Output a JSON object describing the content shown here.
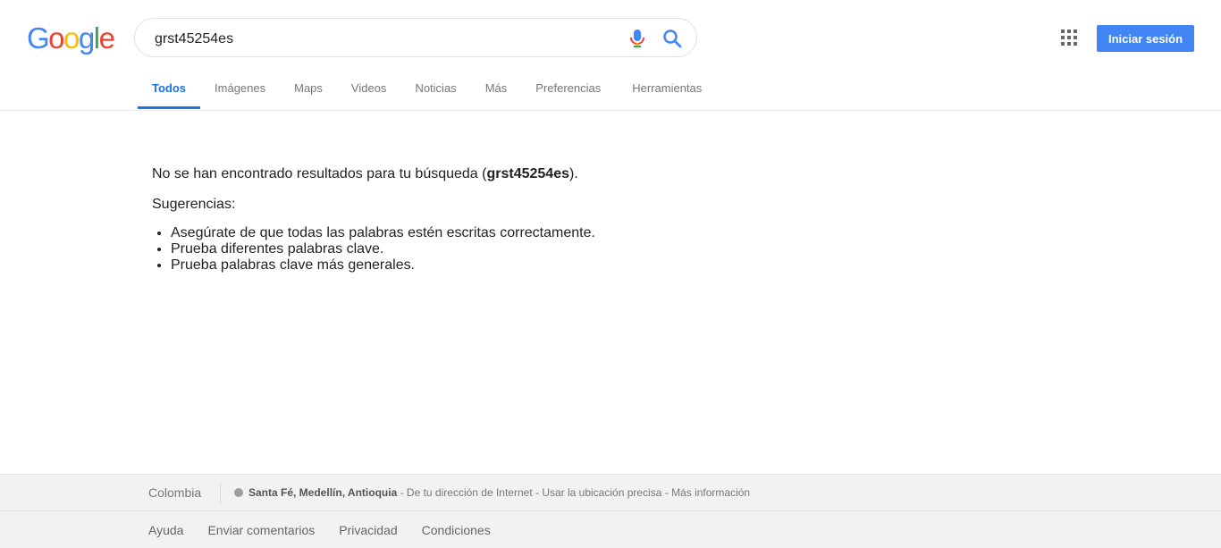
{
  "logo": {
    "letters": [
      "G",
      "o",
      "o",
      "g",
      "l",
      "e"
    ],
    "colors": [
      "#4285f4",
      "#ea4335",
      "#fbbc05",
      "#4285f4",
      "#34a853",
      "#ea4335"
    ]
  },
  "search": {
    "value": "grst45254es"
  },
  "header": {
    "signin_label": "Iniciar sesión"
  },
  "icons": {
    "mic": "microphone-icon",
    "search": "search-icon",
    "apps": "apps-grid-icon"
  },
  "tabs": [
    {
      "label": "Todos",
      "active": true
    },
    {
      "label": "Imágenes"
    },
    {
      "label": "Maps"
    },
    {
      "label": "Videos"
    },
    {
      "label": "Noticias"
    },
    {
      "label": "Más"
    },
    {
      "label": "Preferencias"
    },
    {
      "label": "Herramientas"
    }
  ],
  "results": {
    "no_results_prefix": "No se han encontrado resultados para tu búsqueda (",
    "query": "grst45254es",
    "no_results_suffix": ").",
    "suggestions_title": "Sugerencias:",
    "suggestions": [
      "Asegúrate de que todas las palabras estén escritas correctamente.",
      "Prueba diferentes palabras clave.",
      "Prueba palabras clave más generales."
    ]
  },
  "footer": {
    "country": "Colombia",
    "location_name": "Santa Fé, Medellín, Antioquia",
    "location_source": " - De tu dirección de Internet - ",
    "use_precise": "Usar la ubicación precisa",
    "dash": " - ",
    "more_info": "Más información",
    "links": [
      "Ayuda",
      "Enviar comentarios",
      "Privacidad",
      "Condiciones"
    ]
  },
  "colors": {
    "accent": "#1a73e8",
    "signin_bg": "#4285f4"
  }
}
